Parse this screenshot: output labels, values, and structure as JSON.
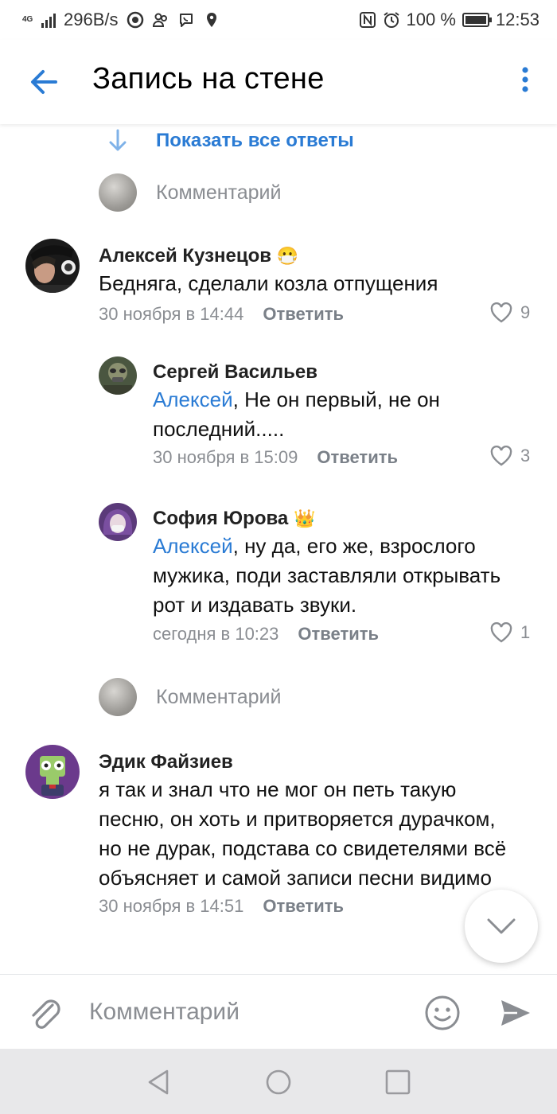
{
  "status_bar": {
    "network_type": "4G",
    "speed": "296B/s",
    "battery_text": "100 %",
    "battery_level": 1.0,
    "time": "12:53"
  },
  "app_bar": {
    "title": "Запись на стене",
    "back_icon": "arrow-left-icon",
    "menu_icon": "more-vertical-icon"
  },
  "thread": {
    "show_all_replies": "Показать все ответы",
    "comment_placeholder": "Комментарий"
  },
  "comments": [
    {
      "author": "Алексей Кузнецов",
      "badge": "😷",
      "text": "Бедняга, сделали козла отпущения",
      "date": "30 ноября в 14:44",
      "reply_label": "Ответить",
      "likes": "9"
    },
    {
      "author": "Сергей Васильев",
      "mention": "Алексей",
      "text": ", Не он первый, не он последний.....",
      "date": "30 ноября в 15:09",
      "reply_label": "Ответить",
      "likes": "3"
    },
    {
      "author": "София Юрова",
      "badge": "👑",
      "mention": "Алексей",
      "text": ", ну да, его же, взрослого мужика, поди заставляли открывать рот и издавать звуки.",
      "date": "сегодня в 10:23",
      "reply_label": "Ответить",
      "likes": "1"
    },
    {
      "author": "Эдик Файзиев",
      "text": "я так и знал что не мог он петь такую песню, он хоть и притворяется дурачком, но не дурак, подстава со свидетелями всё объясняет и самой записи песни видимо нет и не буд",
      "date": "30 ноября в 14:51",
      "reply_label": "Ответить"
    }
  ],
  "compose": {
    "placeholder": "Комментарий",
    "attach_icon": "paperclip-icon",
    "emoji_icon": "smile-icon",
    "send_icon": "send-icon"
  },
  "colors": {
    "accent": "#2a7bd4",
    "secondary_text": "#8a8d92",
    "nav_bar": "#e8e8ea"
  }
}
